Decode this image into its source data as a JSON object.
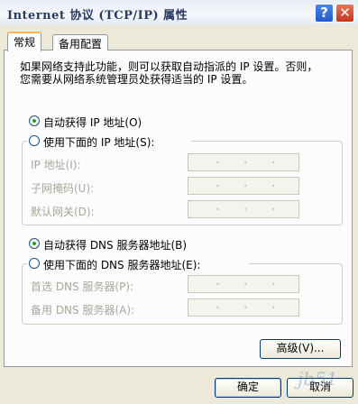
{
  "window": {
    "title": "Internet 协议 (TCP/IP) 属性",
    "help_glyph": "?",
    "close_glyph": "✕"
  },
  "tabs": [
    {
      "label": "常规",
      "active": true
    },
    {
      "label": "备用配置",
      "active": false
    }
  ],
  "description": {
    "line1": "如果网络支持此功能，则可以获取自动指派的 IP 设置。否则，",
    "line2": "您需要从网络系统管理员处获得适当的 IP 设置。"
  },
  "ip": {
    "auto_label": "自动获得 IP 地址(O)",
    "manual_label": "使用下面的 IP 地址(S):",
    "auto_selected": true,
    "fields": [
      {
        "label": "IP 地址(I):"
      },
      {
        "label": "子网掩码(U):"
      },
      {
        "label": "默认网关(D):"
      }
    ]
  },
  "dns": {
    "auto_label": "自动获得 DNS 服务器地址(B)",
    "manual_label": "使用下面的 DNS 服务器地址(E):",
    "auto_selected": true,
    "fields": [
      {
        "label": "首选 DNS 服务器(P):"
      },
      {
        "label": "备用 DNS 服务器(A):"
      }
    ]
  },
  "buttons": {
    "advanced": "高级(V)...",
    "ok": "确定",
    "cancel": "取消"
  },
  "watermark": "jb51"
}
